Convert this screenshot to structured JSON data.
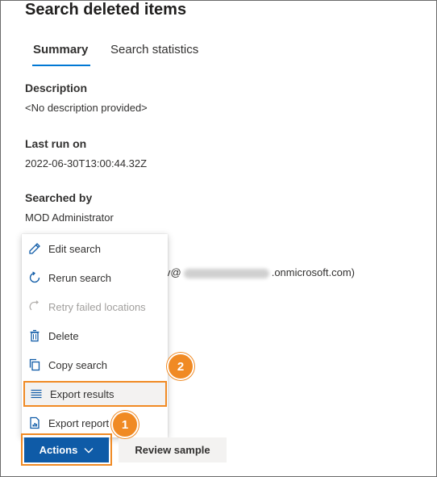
{
  "page": {
    "title": "Search deleted items"
  },
  "tabs": [
    {
      "label": "Summary",
      "selected": true
    },
    {
      "label": "Search statistics",
      "selected": false
    }
  ],
  "details": {
    "description": {
      "label": "Description",
      "value": "<No description provided>"
    },
    "last_run": {
      "label": "Last run on",
      "value": "2022-06-30T13:00:44.32Z"
    },
    "searched_by": {
      "label": "Searched by",
      "value": "MOD Administrator"
    },
    "email_partial": {
      "prefix": "v@",
      "suffix": ".onmicrosoft.com)"
    }
  },
  "actions_menu": {
    "items": [
      {
        "label": "Edit search",
        "icon": "pencil-icon",
        "disabled": false
      },
      {
        "label": "Rerun search",
        "icon": "refresh-icon",
        "disabled": false
      },
      {
        "label": "Retry failed locations",
        "icon": "retry-icon",
        "disabled": true
      },
      {
        "label": "Delete",
        "icon": "trash-icon",
        "disabled": false
      },
      {
        "label": "Copy search",
        "icon": "copy-icon",
        "disabled": false
      },
      {
        "label": "Export results",
        "icon": "list-icon",
        "disabled": false
      },
      {
        "label": "Export report",
        "icon": "report-icon",
        "disabled": false
      }
    ]
  },
  "buttons": {
    "actions_label": "Actions",
    "review_sample_label": "Review sample"
  },
  "callouts": {
    "first": "1",
    "second": "2"
  },
  "colors": {
    "primary": "#0f5ba7",
    "tab_underline": "#0078d4",
    "callout": "#f08a24",
    "menu_icon": "#0f5ba7"
  }
}
